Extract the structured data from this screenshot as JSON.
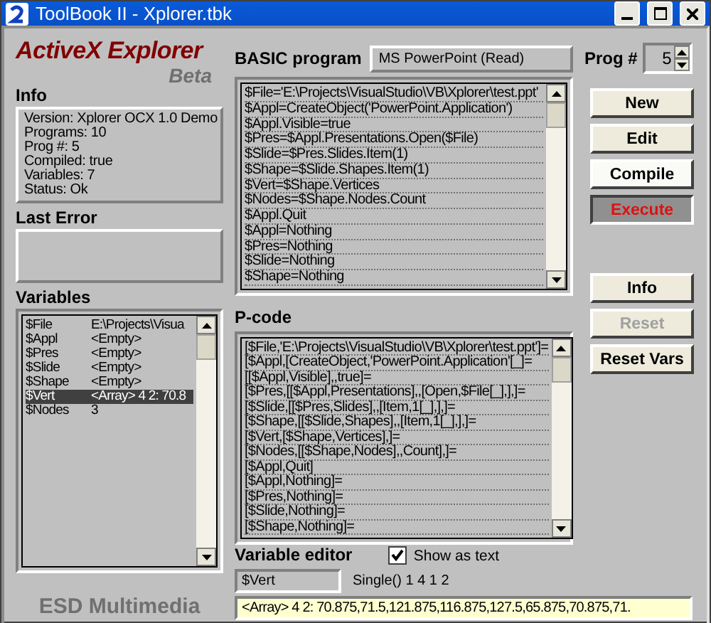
{
  "window": {
    "title": "ToolBook II - Xplorer.tbk"
  },
  "brand": {
    "title": "ActiveX Explorer",
    "subtitle": "Beta",
    "footer": "ESD Multimedia"
  },
  "info": {
    "label": "Info",
    "lines": [
      "Version: Xplorer OCX 1.0 Demo",
      "Programs: 10",
      "Prog #: 5",
      "Compiled: true",
      "Variables: 7",
      "Status: Ok"
    ]
  },
  "last_error": {
    "label": "Last Error"
  },
  "variables": {
    "label": "Variables",
    "rows": [
      {
        "name": "$File",
        "value": "E:\\Projects\\Visua",
        "selected": false
      },
      {
        "name": "$Appl",
        "value": "<Empty>",
        "selected": false
      },
      {
        "name": "$Pres",
        "value": "<Empty>",
        "selected": false
      },
      {
        "name": "$Slide",
        "value": "<Empty>",
        "selected": false
      },
      {
        "name": "$Shape",
        "value": "<Empty>",
        "selected": false
      },
      {
        "name": "$Vert",
        "value": "<Array> 4 2: 70.8",
        "selected": true
      },
      {
        "name": "$Nodes",
        "value": "3",
        "selected": false
      }
    ]
  },
  "program": {
    "label": "BASIC program",
    "name": "MS PowerPoint (Read)",
    "lines": [
      "$File='E:\\Projects\\VisualStudio\\VB\\Xplorer\\test.ppt'",
      "$Appl=CreateObject('PowerPoint.Application')",
      "$Appl.Visible=true",
      "$Pres=$Appl.Presentations.Open($File)",
      "$Slide=$Pres.Slides.Item(1)",
      "$Shape=$Slide.Shapes.Item(1)",
      "$Vert=$Shape.Vertices",
      "$Nodes=$Shape.Nodes.Count",
      "$Appl.Quit",
      "$Appl=Nothing",
      "$Pres=Nothing",
      "$Slide=Nothing",
      "$Shape=Nothing"
    ]
  },
  "prog_number": {
    "label": "Prog #",
    "value": "5"
  },
  "buttons": [
    {
      "label": "New",
      "pressed": false,
      "focused": false,
      "disabled": false,
      "danger": false
    },
    {
      "label": "Edit",
      "pressed": false,
      "focused": false,
      "disabled": false,
      "danger": false
    },
    {
      "label": "Compile",
      "pressed": false,
      "focused": true,
      "disabled": false,
      "danger": false
    },
    {
      "label": "Execute",
      "pressed": true,
      "focused": false,
      "disabled": false,
      "danger": true
    }
  ],
  "buttons_lower": [
    {
      "label": "Info",
      "pressed": false,
      "focused": false,
      "disabled": false,
      "danger": false
    },
    {
      "label": "Reset",
      "pressed": false,
      "focused": false,
      "disabled": true,
      "danger": false
    },
    {
      "label": "Reset Vars",
      "pressed": false,
      "focused": false,
      "disabled": false,
      "danger": false
    }
  ],
  "pcode": {
    "label": "P-code",
    "lines": [
      "[$File,'E:\\Projects\\VisualStudio\\VB\\Xplorer\\test.ppt']=",
      "[$Appl,[CreateObject,'PowerPoint.Application'[_]=",
      "[[$Appl,Visible],,true]=",
      "[$Pres,[[$Appl,Presentations],,[Open,$File[_],],]=",
      "[$Slide,[[$Pres,Slides],,[Item,1[_],],]=",
      "[$Shape,[[$Slide,Shapes],,[Item,1[_],],]=",
      "[$Vert,[$Shape,Vertices],]=",
      "[$Nodes,[[$Shape,Nodes],,Count],]=",
      "[$Appl,Quit]",
      "[$Appl,Nothing]=",
      "[$Pres,Nothing]=",
      "[$Slide,Nothing]=",
      "[$Shape,Nothing]="
    ]
  },
  "variable_editor": {
    "label": "Variable editor",
    "name": "$Vert",
    "type": "Single() 1 4 1 2",
    "show_as_text": {
      "label": "Show as text",
      "checked": true
    },
    "value": "<Array> 4 2: 70.875,71.5,121.875,116.875,127.5,65.875,70.875,71."
  }
}
